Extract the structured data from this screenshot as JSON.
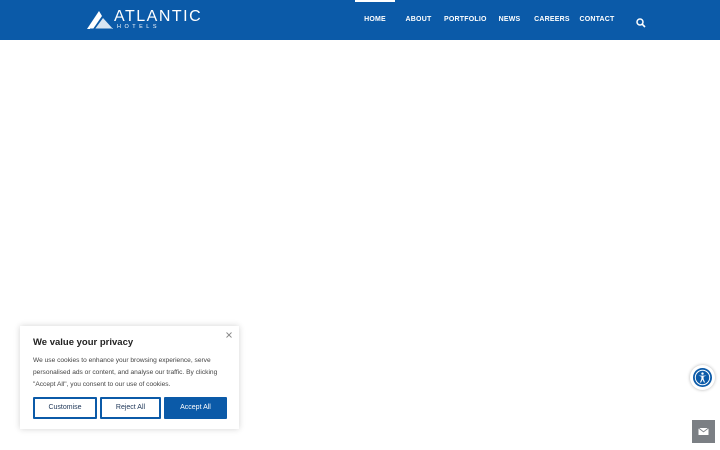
{
  "brand": {
    "name": "ATLANTIC",
    "subtitle": "HOTELS",
    "color": "#0b5aa8"
  },
  "nav": {
    "items": [
      {
        "label": "HOME",
        "active": true
      },
      {
        "label": "ABOUT",
        "active": false
      },
      {
        "label": "PORTFOLIO",
        "active": false
      },
      {
        "label": "NEWS",
        "active": false
      },
      {
        "label": "CAREERS",
        "active": false
      },
      {
        "label": "CONTACT",
        "active": false
      }
    ],
    "search_icon": "search-icon"
  },
  "cookie": {
    "title": "We value your privacy",
    "text": "We use cookies to enhance your browsing experience, serve personalised ads or content, and analyse our traffic. By clicking \"Accept All\", you consent to our use of cookies.",
    "close_icon": "close-icon",
    "customise_label": "Customise",
    "reject_label": "Reject All",
    "accept_label": "Accept All"
  },
  "floating": {
    "accessibility_icon": "accessibility-icon",
    "mail_icon": "envelope-icon"
  }
}
